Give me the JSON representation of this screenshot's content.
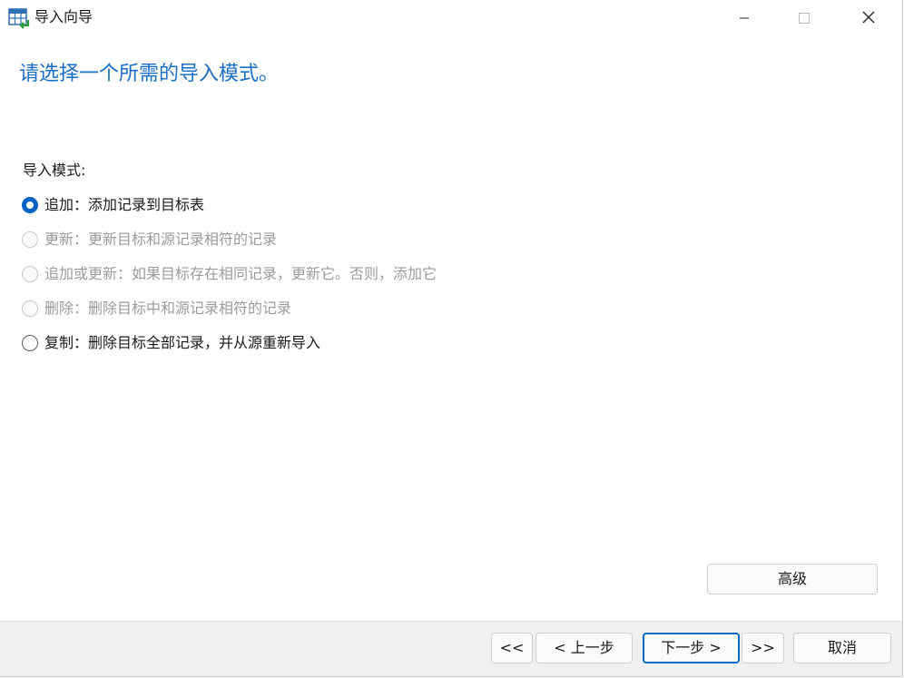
{
  "window": {
    "title": "导入向导",
    "app_icon": "table-import-icon",
    "controls": {
      "minimize": "minimize-icon",
      "maximize": "maximize-icon",
      "close": "close-icon"
    }
  },
  "heading": "请选择一个所需的导入模式。",
  "mode": {
    "label": "导入模式:",
    "options": [
      {
        "label": "追加：添加记录到目标表",
        "checked": true,
        "enabled": true
      },
      {
        "label": "更新：更新目标和源记录相符的记录",
        "checked": false,
        "enabled": false
      },
      {
        "label": "追加或更新：如果目标存在相同记录，更新它。否则，添加它",
        "checked": false,
        "enabled": false
      },
      {
        "label": "删除：删除目标中和源记录相符的记录",
        "checked": false,
        "enabled": false
      },
      {
        "label": "复制：删除目标全部记录，并从源重新导入",
        "checked": false,
        "enabled": true
      }
    ]
  },
  "buttons": {
    "advanced": "高级",
    "first": "<<",
    "prev": "< 上一步",
    "next": "下一步 >",
    "last": ">>",
    "cancel": "取消"
  },
  "colors": {
    "heading": "#1a6fc4",
    "accent": "#0062c4",
    "disabled_text": "#9b9b9b",
    "footer_bg": "#f0f0f0"
  }
}
